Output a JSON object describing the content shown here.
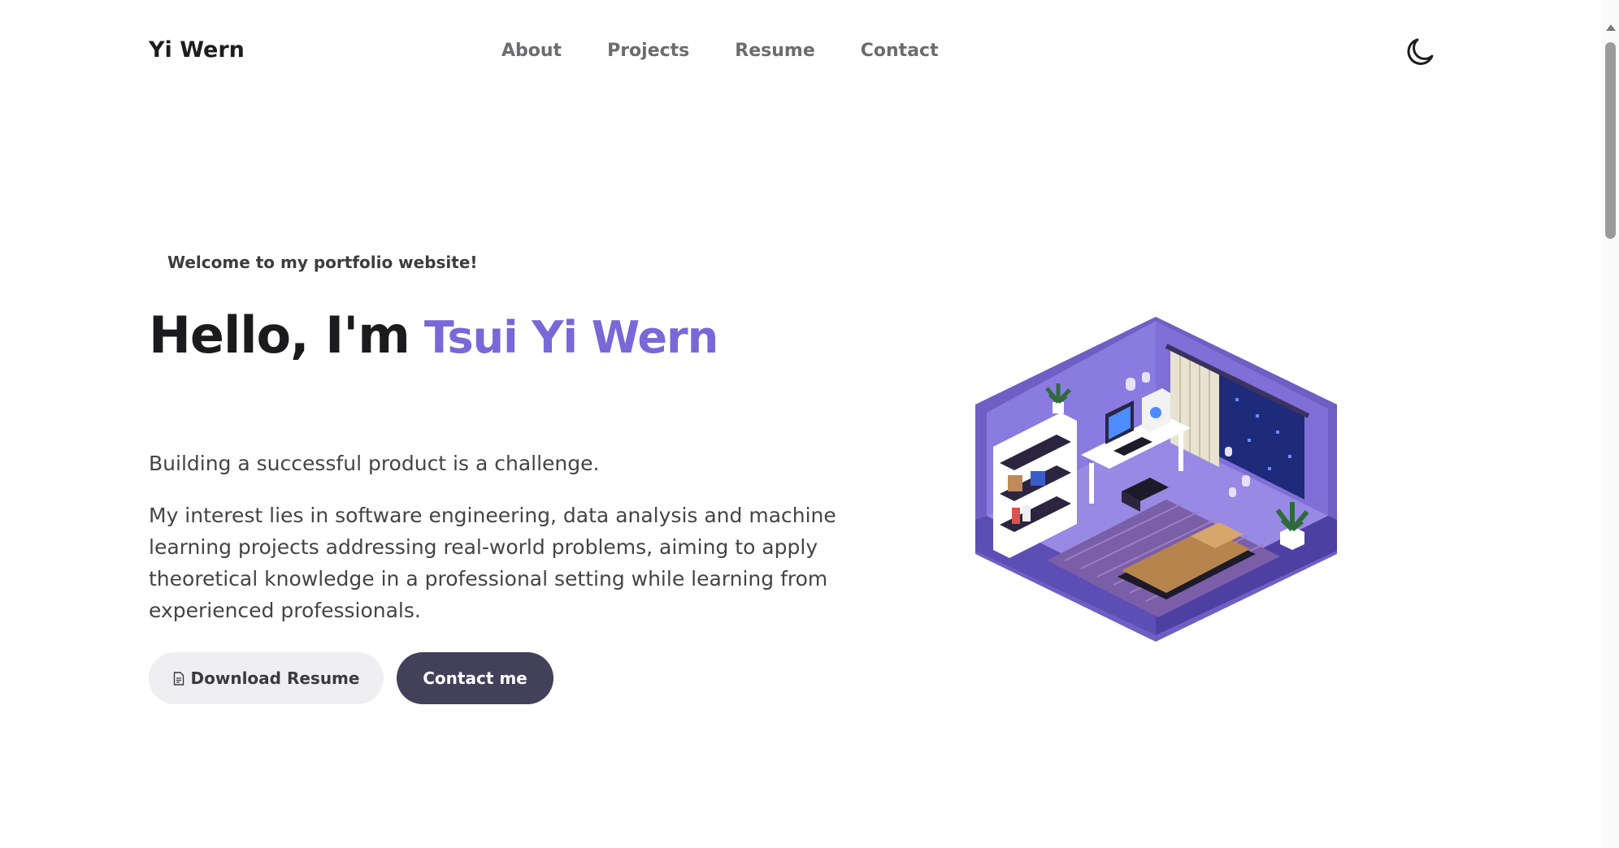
{
  "header": {
    "brand": "Yi Wern",
    "nav": [
      "About",
      "Projects",
      "Resume",
      "Contact"
    ],
    "theme_toggle_icon": "moon-icon"
  },
  "hero": {
    "welcome": "Welcome to my portfolio website!",
    "greeting": "Hello, I'm",
    "name": "Tsui Yi Wern",
    "tagline": "Building a successful product is a challenge.",
    "description": "My interest lies in software engineering, data analysis and machine learning projects addressing real-world problems, aiming to apply theoretical knowledge in a professional setting while learning from experienced professionals.",
    "download_button": "Download Resume",
    "contact_button": "Contact me",
    "illustration_icon": "isometric-room-illustration"
  },
  "colors": {
    "accent": "#7868d8",
    "button_dark": "#43405a",
    "button_light": "#efeff1",
    "room_purple": "#7b6ad0"
  }
}
